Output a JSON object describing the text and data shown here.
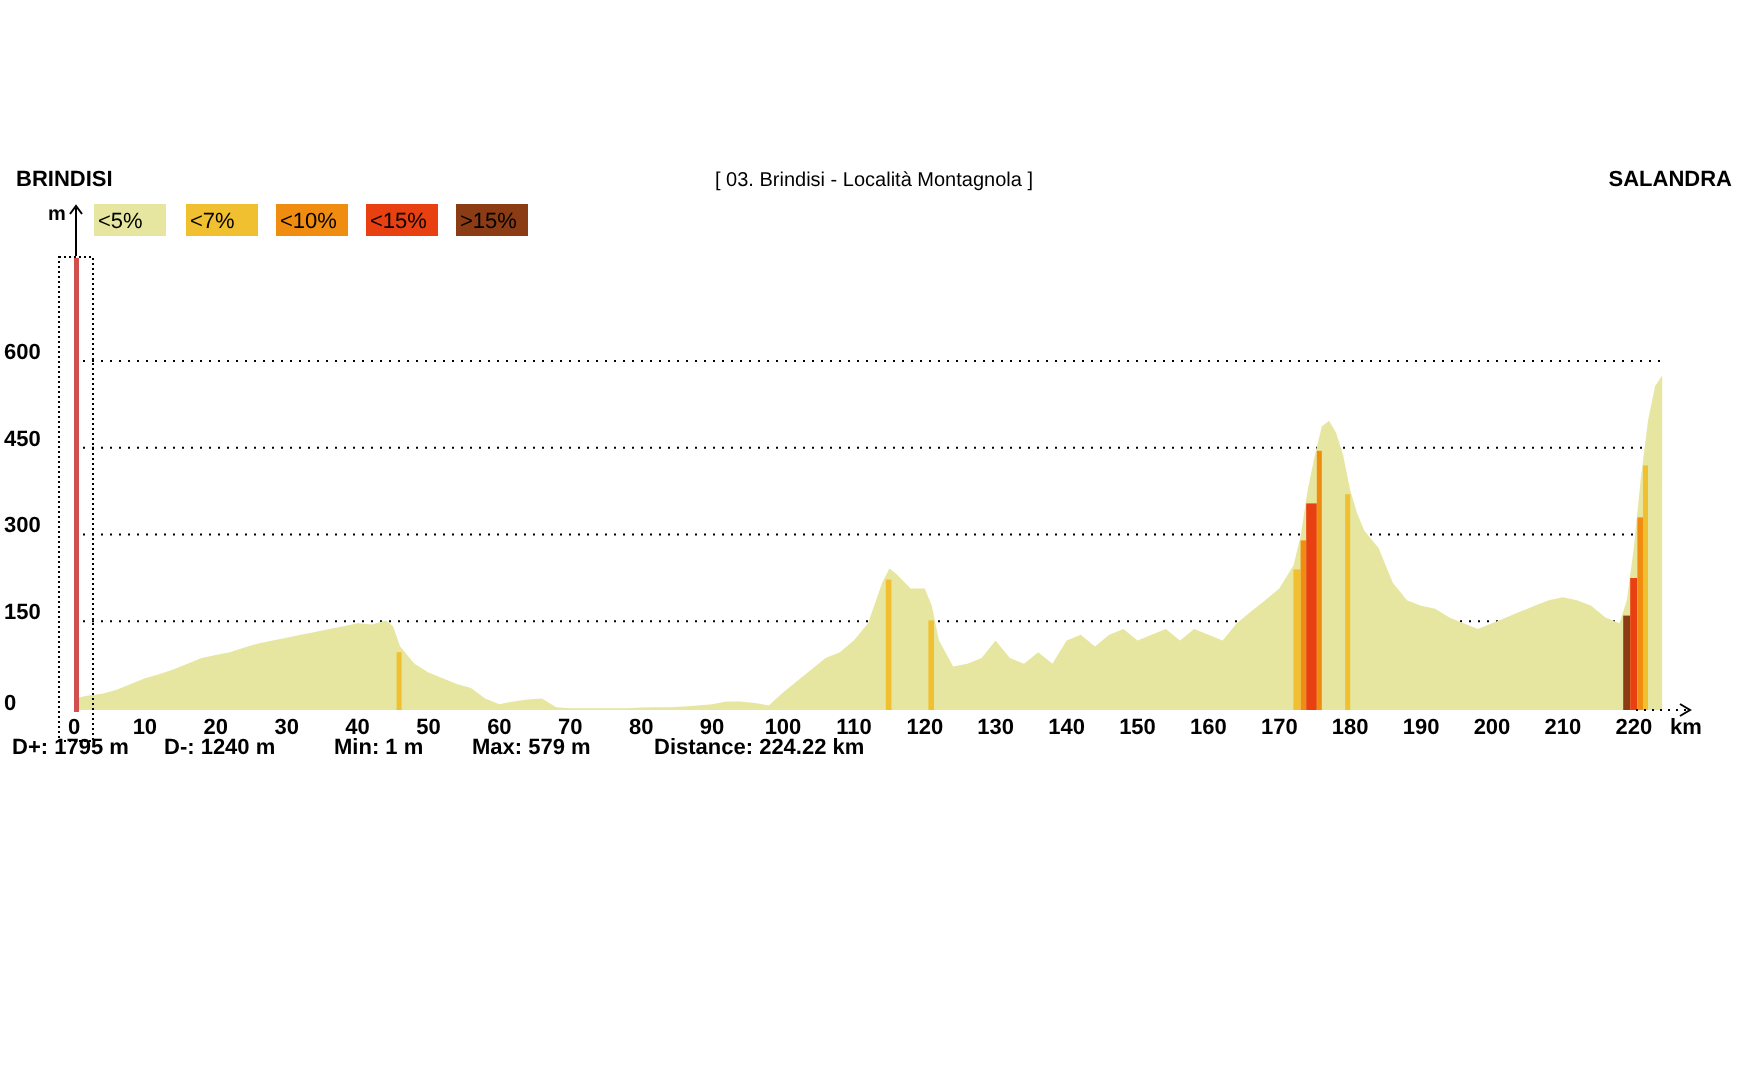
{
  "header": {
    "start": "BRINDISI",
    "route": "[ 03. Brindisi - Località Montagnola ]",
    "end": "SALANDRA"
  },
  "legend": [
    {
      "label": "<5%",
      "color": "#e6e6a0"
    },
    {
      "label": "<7%",
      "color": "#f0c030"
    },
    {
      "label": "<10%",
      "color": "#f08c10"
    },
    {
      "label": "<15%",
      "color": "#e84010"
    },
    {
      "label": ">15%",
      "color": "#8c3c14"
    }
  ],
  "chart_data": {
    "type": "area",
    "xlabel": "km",
    "ylabel": "m",
    "x": [
      0,
      2,
      4,
      6,
      8,
      10,
      12,
      14,
      16,
      18,
      20,
      22,
      24,
      26,
      28,
      30,
      32,
      34,
      36,
      38,
      40,
      42,
      44,
      45,
      46,
      48,
      50,
      52,
      54,
      56,
      58,
      60,
      62,
      64,
      66,
      68,
      70,
      72,
      74,
      76,
      78,
      80,
      82,
      84,
      86,
      88,
      90,
      92,
      94,
      96,
      98,
      100,
      102,
      104,
      106,
      108,
      110,
      112,
      114,
      115,
      116,
      118,
      120,
      121,
      122,
      124,
      126,
      128,
      130,
      132,
      134,
      136,
      138,
      140,
      142,
      144,
      146,
      148,
      150,
      152,
      154,
      156,
      158,
      160,
      162,
      164,
      166,
      168,
      170,
      172,
      173,
      174,
      175,
      176,
      177,
      178,
      179,
      180,
      181,
      182,
      184,
      186,
      188,
      190,
      192,
      194,
      196,
      198,
      200,
      202,
      204,
      206,
      208,
      210,
      212,
      214,
      216,
      218,
      219,
      220,
      221,
      222,
      223,
      224
    ],
    "series": [
      {
        "color": "#e6e6a0",
        "values": [
          20,
          25,
          28,
          35,
          45,
          55,
          62,
          70,
          80,
          90,
          95,
          100,
          108,
          115,
          120,
          125,
          130,
          135,
          140,
          145,
          150,
          148,
          155,
          145,
          110,
          80,
          65,
          55,
          45,
          38,
          20,
          10,
          15,
          18,
          20,
          5,
          3,
          3,
          3,
          3,
          3,
          4,
          5,
          5,
          6,
          8,
          10,
          15,
          15,
          12,
          8,
          30,
          50,
          70,
          90,
          100,
          120,
          150,
          220,
          245,
          235,
          210,
          210,
          180,
          120,
          75,
          80,
          90,
          120,
          90,
          80,
          100,
          80,
          120,
          130,
          110,
          130,
          140,
          120,
          130,
          140,
          120,
          140,
          130,
          120,
          150,
          170,
          190,
          210,
          250,
          300,
          380,
          440,
          490,
          500,
          480,
          440,
          380,
          340,
          310,
          280,
          220,
          190,
          180,
          175,
          160,
          150,
          140,
          150,
          160,
          170,
          180,
          190,
          195,
          190,
          180,
          160,
          150,
          190,
          280,
          400,
          500,
          560,
          579
        ]
      }
    ],
    "xlim": [
      0,
      224.22
    ],
    "ylim": [
      0,
      785
    ],
    "grid": true,
    "xticks": [
      0,
      10,
      20,
      30,
      40,
      50,
      60,
      70,
      80,
      90,
      100,
      110,
      120,
      130,
      140,
      150,
      160,
      170,
      180,
      190,
      200,
      210,
      220
    ],
    "yticks": [
      0,
      150,
      300,
      450,
      600
    ],
    "bands": [
      {
        "axis": "x",
        "from": 45.5,
        "to": 46.2,
        "color": "#f0c030"
      },
      {
        "axis": "x",
        "from": 114.5,
        "to": 115.3,
        "color": "#f0c030"
      },
      {
        "axis": "x",
        "from": 120.5,
        "to": 121.3,
        "color": "#f0c030"
      },
      {
        "axis": "x",
        "from": 172,
        "to": 173,
        "color": "#f0c030"
      },
      {
        "axis": "x",
        "from": 173,
        "to": 173.8,
        "color": "#f08c10"
      },
      {
        "axis": "x",
        "from": 173.8,
        "to": 175.3,
        "color": "#e84010"
      },
      {
        "axis": "x",
        "from": 175.3,
        "to": 176,
        "color": "#f08c10"
      },
      {
        "axis": "x",
        "from": 179.3,
        "to": 180,
        "color": "#f0c030"
      },
      {
        "axis": "x",
        "from": 218.5,
        "to": 219.5,
        "color": "#8c3c14"
      },
      {
        "axis": "x",
        "from": 219.5,
        "to": 220.5,
        "color": "#e84010"
      },
      {
        "axis": "x",
        "from": 220.5,
        "to": 221.3,
        "color": "#f08c10"
      },
      {
        "axis": "x",
        "from": 221.3,
        "to": 222,
        "color": "#f0c030"
      }
    ]
  },
  "stats": [
    "D+: 1795 m",
    "D-: 1240 m",
    "Min: 1 m",
    "Max: 579 m",
    "Distance: 224.22 km"
  ]
}
